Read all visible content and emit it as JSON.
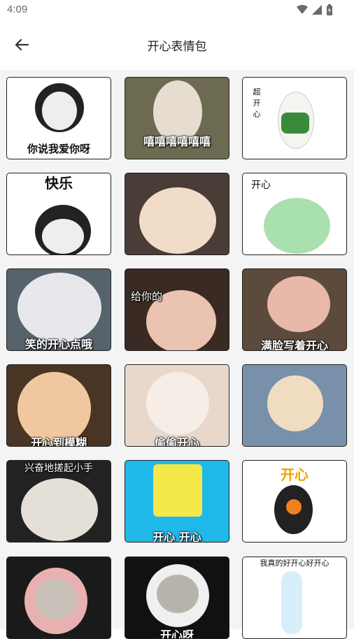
{
  "status_bar": {
    "time": "4:09"
  },
  "header": {
    "title": "开心表情包"
  },
  "stickers": [
    {
      "caption": "你说我爱你呀",
      "caption2": "",
      "bg": "#ffffff"
    },
    {
      "caption": "嘻嘻嘻嘻嘻嘻",
      "caption2": "",
      "bg": "#6c6a50"
    },
    {
      "caption": "超开心",
      "caption2": "",
      "bg": "#ffffff"
    },
    {
      "caption": "快乐",
      "caption2": "",
      "bg": "#ffffff"
    },
    {
      "caption": "",
      "caption2": "",
      "bg": "#4a3c36"
    },
    {
      "caption": "开心",
      "caption2": "",
      "bg": "#ffffff"
    },
    {
      "caption": "笑的开心点哦",
      "caption2": "",
      "bg": "#56626c"
    },
    {
      "caption": "给你的",
      "caption2": "",
      "bg": "#3a2a24"
    },
    {
      "caption": "满脸写着开心",
      "caption2": "",
      "bg": "#5c4a3c"
    },
    {
      "caption": "开心到模糊",
      "caption2": "",
      "bg": "#4a3424"
    },
    {
      "caption": "偷偷开心",
      "caption2": "",
      "bg": "#e8d8cc"
    },
    {
      "caption": "",
      "caption2": "",
      "bg": "#7890aa"
    },
    {
      "caption": "兴奋地搓起小手",
      "caption2": "",
      "bg": "#222222"
    },
    {
      "caption": "开心 开心",
      "caption2": "",
      "bg": "#20b8e8"
    },
    {
      "caption": "开心",
      "caption2": "",
      "bg": "#ffffff"
    },
    {
      "caption": "",
      "caption2": "",
      "bg": "#1a1a1a"
    },
    {
      "caption": "开心呀",
      "caption2": "",
      "bg": "#111111"
    },
    {
      "caption": "我真的好开心好开心",
      "caption2": "",
      "bg": "#ffffff"
    }
  ]
}
